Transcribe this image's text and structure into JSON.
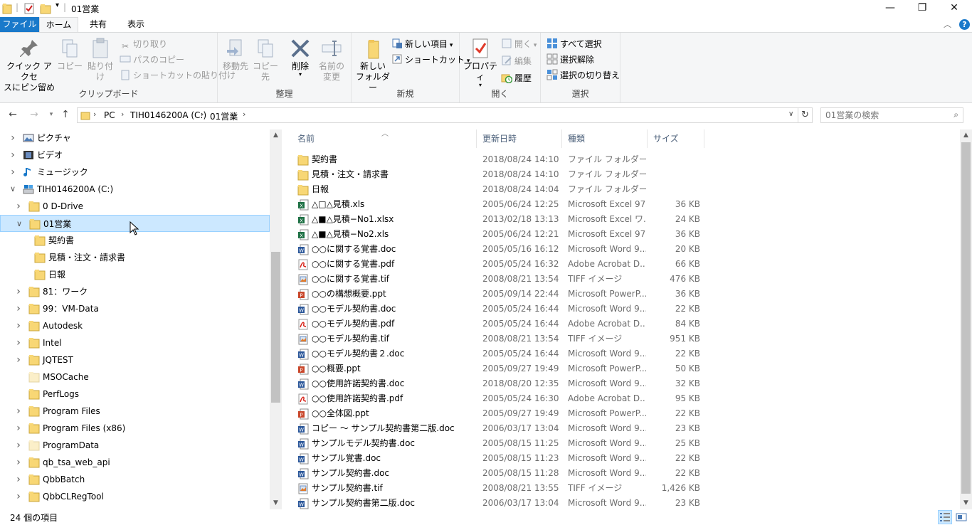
{
  "window": {
    "title": "01営業",
    "minimize": "—",
    "maximize": "❐",
    "close": "✕"
  },
  "tabs": {
    "file": "ファイル",
    "home": "ホーム",
    "share": "共有",
    "view": "表示"
  },
  "ribbon": {
    "clipboard": {
      "label": "クリップボード",
      "pin": [
        "クイック アクセ",
        "スにピン留め"
      ],
      "copy": "コピー",
      "paste": "貼り付け",
      "cut": "切り取り",
      "copy_path": "パスのコピー",
      "paste_shortcut": "ショートカットの貼り付け"
    },
    "organize": {
      "label": "整理",
      "move_to": "移動先",
      "copy_to": "コピー先",
      "delete": "削除",
      "rename": [
        "名前の",
        "変更"
      ]
    },
    "new": {
      "label": "新規",
      "new_folder": [
        "新しい",
        "フォルダー"
      ],
      "new_item": "新しい項目",
      "shortcut": "ショートカット"
    },
    "open": {
      "label": "開く",
      "properties": "プロパティ",
      "open": "開く",
      "edit": "編集",
      "history": "履歴"
    },
    "select": {
      "label": "選択",
      "select_all": "すべて選択",
      "select_none": "選択解除",
      "invert": "選択の切り替え"
    }
  },
  "address": {
    "crumbs": [
      "PC",
      "TIH0146200A (C:)",
      "01営業"
    ],
    "search_placeholder": "01営業の検索"
  },
  "nav_tree": [
    {
      "label": "ピクチャ",
      "level": 0,
      "chevron": "right",
      "icon": "pictures-icon"
    },
    {
      "label": "ビデオ",
      "level": 0,
      "chevron": "right",
      "icon": "videos-icon"
    },
    {
      "label": "ミュージック",
      "level": 0,
      "chevron": "right",
      "icon": "music-icon"
    },
    {
      "label": "TIH0146200A (C:)",
      "level": 0,
      "chevron": "down",
      "icon": "drive-icon"
    },
    {
      "label": "0 D-Drive",
      "level": 1,
      "chevron": "right",
      "icon": "folder-icon"
    },
    {
      "label": "01営業",
      "level": 1,
      "chevron": "down",
      "icon": "folder-icon",
      "selected": true
    },
    {
      "label": "契約書",
      "level": 2,
      "chevron": "",
      "icon": "folder-icon"
    },
    {
      "label": "見積・注文・請求書",
      "level": 2,
      "chevron": "",
      "icon": "folder-icon"
    },
    {
      "label": "日報",
      "level": 2,
      "chevron": "",
      "icon": "folder-icon"
    },
    {
      "label": "81：ワーク",
      "level": 1,
      "chevron": "right",
      "icon": "folder-icon"
    },
    {
      "label": "99：VM-Data",
      "level": 1,
      "chevron": "right",
      "icon": "folder-icon"
    },
    {
      "label": "Autodesk",
      "level": 1,
      "chevron": "right",
      "icon": "folder-icon"
    },
    {
      "label": "Intel",
      "level": 1,
      "chevron": "right",
      "icon": "folder-icon"
    },
    {
      "label": "JQTEST",
      "level": 1,
      "chevron": "right",
      "icon": "folder-icon"
    },
    {
      "label": "MSOCache",
      "level": 1,
      "chevron": "",
      "icon": "folder-hidden-icon"
    },
    {
      "label": "PerfLogs",
      "level": 1,
      "chevron": "",
      "icon": "folder-icon"
    },
    {
      "label": "Program Files",
      "level": 1,
      "chevron": "right",
      "icon": "folder-icon"
    },
    {
      "label": "Program Files (x86)",
      "level": 1,
      "chevron": "right",
      "icon": "folder-icon"
    },
    {
      "label": "ProgramData",
      "level": 1,
      "chevron": "right",
      "icon": "folder-hidden-icon"
    },
    {
      "label": "qb_tsa_web_api",
      "level": 1,
      "chevron": "right",
      "icon": "folder-icon"
    },
    {
      "label": "QbbBatch",
      "level": 1,
      "chevron": "right",
      "icon": "folder-icon"
    },
    {
      "label": "QbbCLRegTool",
      "level": 1,
      "chevron": "right",
      "icon": "folder-icon"
    }
  ],
  "columns": {
    "name": "名前",
    "date": "更新日時",
    "type": "種類",
    "size": "サイズ"
  },
  "files": [
    {
      "name": "契約書",
      "date": "2018/08/24 14:10",
      "type": "ファイル フォルダー",
      "size": "",
      "icon": "folder"
    },
    {
      "name": "見積・注文・請求書",
      "date": "2018/08/24 14:10",
      "type": "ファイル フォルダー",
      "size": "",
      "icon": "folder"
    },
    {
      "name": "日報",
      "date": "2018/08/24 14:04",
      "type": "ファイル フォルダー",
      "size": "",
      "icon": "folder"
    },
    {
      "name": "△□△見積.xls",
      "date": "2005/06/24 12:25",
      "type": "Microsoft Excel 97...",
      "size": "36 KB",
      "icon": "excel"
    },
    {
      "name": "△■△見積−No1.xlsx",
      "date": "2013/02/18 13:13",
      "type": "Microsoft Excel ワ...",
      "size": "24 KB",
      "icon": "excel"
    },
    {
      "name": "△■△見積−No2.xls",
      "date": "2005/06/24 12:21",
      "type": "Microsoft Excel 97...",
      "size": "36 KB",
      "icon": "excel"
    },
    {
      "name": "○○に関する覚書.doc",
      "date": "2005/05/16 16:12",
      "type": "Microsoft Word 9...",
      "size": "20 KB",
      "icon": "word"
    },
    {
      "name": "○○に関する覚書.pdf",
      "date": "2005/05/24 16:32",
      "type": "Adobe Acrobat D...",
      "size": "66 KB",
      "icon": "pdf"
    },
    {
      "name": "○○に関する覚書.tif",
      "date": "2008/08/21 13:54",
      "type": "TIFF イメージ",
      "size": "476 KB",
      "icon": "tif"
    },
    {
      "name": "○○の構想概要.ppt",
      "date": "2005/09/14 22:44",
      "type": "Microsoft PowerP...",
      "size": "36 KB",
      "icon": "ppt"
    },
    {
      "name": "○○モデル契約書.doc",
      "date": "2005/05/24 16:44",
      "type": "Microsoft Word 9...",
      "size": "22 KB",
      "icon": "word"
    },
    {
      "name": "○○モデル契約書.pdf",
      "date": "2005/05/24 16:44",
      "type": "Adobe Acrobat D...",
      "size": "84 KB",
      "icon": "pdf"
    },
    {
      "name": "○○モデル契約書.tif",
      "date": "2008/08/21 13:54",
      "type": "TIFF イメージ",
      "size": "951 KB",
      "icon": "tif"
    },
    {
      "name": "○○モデル契約書２.doc",
      "date": "2005/05/24 16:44",
      "type": "Microsoft Word 9...",
      "size": "22 KB",
      "icon": "word"
    },
    {
      "name": "○○概要.ppt",
      "date": "2005/09/27 19:49",
      "type": "Microsoft PowerP...",
      "size": "50 KB",
      "icon": "ppt"
    },
    {
      "name": "○○使用許諾契約書.doc",
      "date": "2018/08/20 12:35",
      "type": "Microsoft Word 9...",
      "size": "32 KB",
      "icon": "word"
    },
    {
      "name": "○○使用許諾契約書.pdf",
      "date": "2005/05/24 16:30",
      "type": "Adobe Acrobat D...",
      "size": "95 KB",
      "icon": "pdf"
    },
    {
      "name": "○○全体図.ppt",
      "date": "2005/09/27 19:49",
      "type": "Microsoft PowerP...",
      "size": "22 KB",
      "icon": "ppt"
    },
    {
      "name": "コピー 〜 サンプル契約書第二版.doc",
      "date": "2006/03/17 13:04",
      "type": "Microsoft Word 9...",
      "size": "23 KB",
      "icon": "word"
    },
    {
      "name": "サンプルモデル契約書.doc",
      "date": "2005/08/15 11:25",
      "type": "Microsoft Word 9...",
      "size": "25 KB",
      "icon": "word"
    },
    {
      "name": "サンプル覚書.doc",
      "date": "2005/08/15 11:23",
      "type": "Microsoft Word 9...",
      "size": "22 KB",
      "icon": "word"
    },
    {
      "name": "サンプル契約書.doc",
      "date": "2005/08/15 11:28",
      "type": "Microsoft Word 9...",
      "size": "22 KB",
      "icon": "word"
    },
    {
      "name": "サンプル契約書.tif",
      "date": "2008/08/21 13:55",
      "type": "TIFF イメージ",
      "size": "1,426 KB",
      "icon": "tif"
    },
    {
      "name": "サンプル契約書第二版.doc",
      "date": "2006/03/17 13:04",
      "type": "Microsoft Word 9...",
      "size": "23 KB",
      "icon": "word"
    }
  ],
  "status": {
    "count": "24 個の項目"
  },
  "colors": {
    "file_tab": "#1979ca",
    "selection": "#cce8ff",
    "folder": "#f8d775"
  }
}
